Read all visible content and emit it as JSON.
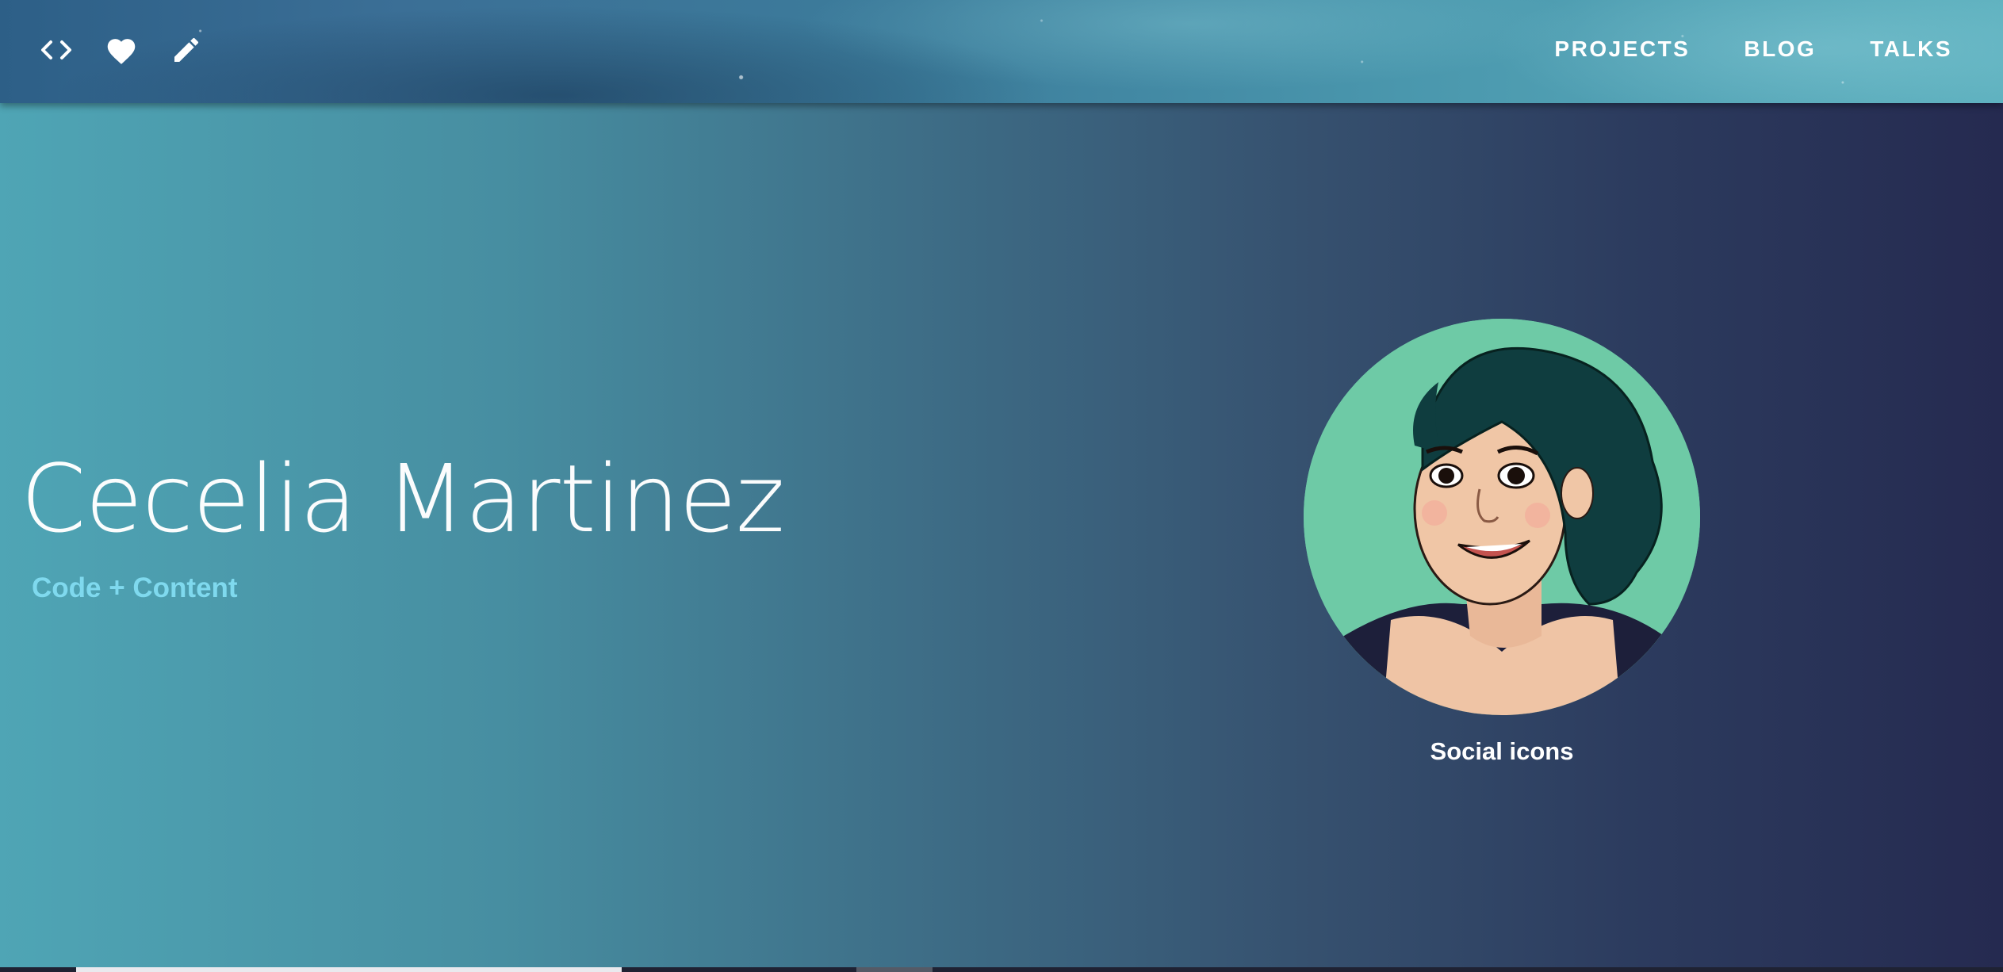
{
  "nav": {
    "icons": [
      {
        "name": "code-icon"
      },
      {
        "name": "heart-icon"
      },
      {
        "name": "pencil-icon"
      }
    ],
    "links": [
      {
        "label": "PROJECTS"
      },
      {
        "label": "BLOG"
      },
      {
        "label": "TALKS"
      }
    ]
  },
  "hero": {
    "name": "Cecelia Martinez",
    "tagline": "Code + Content",
    "social_label": "Social icons"
  },
  "colors": {
    "tagline": "#7fd9ee",
    "gradient_left": "#4fa5b5",
    "gradient_right": "#252a50",
    "avatar_bg": "#6ecaa6"
  }
}
